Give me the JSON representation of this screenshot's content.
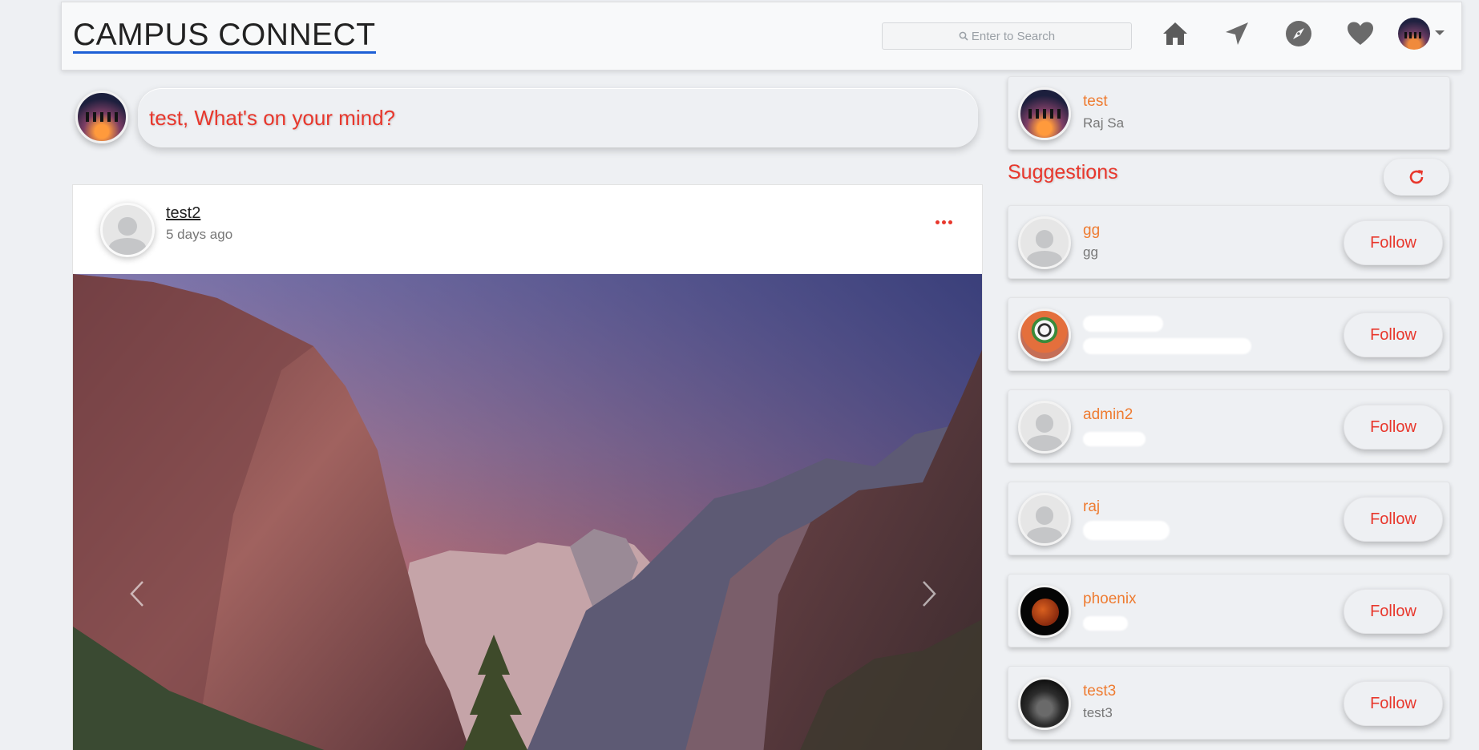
{
  "navbar": {
    "brand": "CAMPUS CONNECT",
    "search_placeholder": "Enter to Search",
    "icons": [
      "home-icon",
      "send-icon",
      "explore-icon",
      "heart-icon"
    ]
  },
  "composer": {
    "prompt": "test, What's on your mind?"
  },
  "post": {
    "username": "test2",
    "time": "5 days ago"
  },
  "profile": {
    "username": "test",
    "fullname": "Raj Sa"
  },
  "suggestions": {
    "title": "Suggestions",
    "items": [
      {
        "username": "gg",
        "fullname": "gg",
        "follow_label": "Follow"
      },
      {
        "username": "",
        "fullname": "",
        "follow_label": "Follow"
      },
      {
        "username": "admin2",
        "fullname": "",
        "follow_label": "Follow"
      },
      {
        "username": "raj",
        "fullname": "",
        "follow_label": "Follow"
      },
      {
        "username": "phoenix",
        "fullname": "",
        "follow_label": "Follow"
      },
      {
        "username": "test3",
        "fullname": "test3",
        "follow_label": "Follow"
      }
    ]
  },
  "colors": {
    "accent_red": "#e8372c",
    "name_orange": "#ee7b30",
    "background": "#eef0f3"
  }
}
